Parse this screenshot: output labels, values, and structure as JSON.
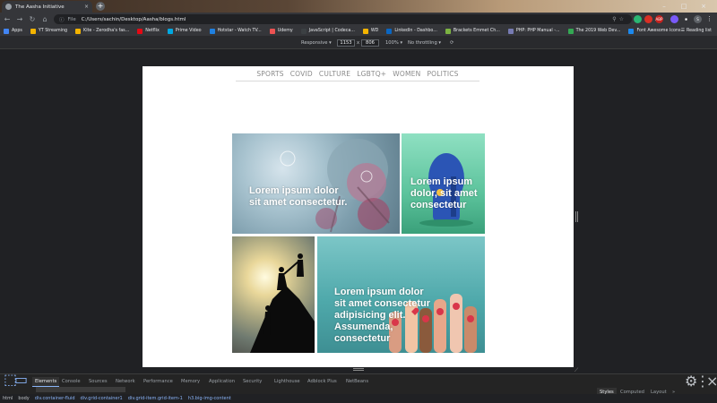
{
  "browser": {
    "tab_title": "The Aasha Initiative",
    "tab_close": "×",
    "new_tab": "+",
    "window_controls": [
      "–",
      "□",
      "×"
    ],
    "nav": {
      "back": "←",
      "forward": "→",
      "reload": "↻",
      "home": "⌂"
    },
    "omnibox": {
      "info": "ⓘ",
      "scheme_label": "File",
      "url": "C:/Users/sachin/Desktop/Aasha/blogs.html",
      "actions": "⚲☆"
    },
    "extensions": [
      {
        "label": "",
        "color": "#2bb673"
      },
      {
        "label": "",
        "color": "#d93025"
      },
      {
        "label": "ABP",
        "color": "#c5221f"
      },
      {
        "label": "",
        "color": "#7a5af8"
      },
      {
        "label": "S",
        "color": "#5f6368"
      }
    ],
    "menu": "⋮"
  },
  "bookmarks": [
    {
      "label": "Apps",
      "color": "#4285f4"
    },
    {
      "label": "YT Streaming",
      "color": "#f4b400"
    },
    {
      "label": "Kite - Zerodha's fas...",
      "color": "#f4b400"
    },
    {
      "label": "Netflix",
      "color": "#e50914"
    },
    {
      "label": "Prime Video",
      "color": "#00a8e1"
    },
    {
      "label": "Hotstar - Watch TV...",
      "color": "#1f80e0"
    },
    {
      "label": "Udemy",
      "color": "#ec5252"
    },
    {
      "label": "JavaScript | Codeca...",
      "color": "#3c4043"
    },
    {
      "label": "WD",
      "color": "#f4b400"
    },
    {
      "label": "LinkedIn - Dashbo...",
      "color": "#0a66c2"
    },
    {
      "label": "Brackets Emmet Ch...",
      "color": "#7cb342"
    },
    {
      "label": "PHP: PHP Manual -...",
      "color": "#777bb3"
    },
    {
      "label": "The 2019 Web Dev...",
      "color": "#34a853"
    },
    {
      "label": "Font Awesome Icons",
      "color": "#1c88ed"
    }
  ],
  "reading_list": "Reading list",
  "device_toolbar": {
    "mode": "Responsive ▾",
    "width": "1153",
    "x": "x",
    "height": "806",
    "zoom": "100% ▾",
    "throttle": "No throttling ▾",
    "rotate": "⟳"
  },
  "page": {
    "nav_items": [
      "SPORTS",
      "COVID",
      "CULTURE",
      "LGBTQ+",
      "WOMEN",
      "POLITICS"
    ],
    "cards": [
      {
        "text": "Lorem ipsum dolor sit amet consectetur."
      },
      {
        "text": "Lorem ipsum dolor, sit amet consectetur"
      },
      {
        "text": ""
      },
      {
        "text": "Lorem ipsum dolor sit amet consectetur adipisicing elit. Assumenda, consectetur"
      }
    ]
  },
  "devtools": {
    "tabs": [
      "Elements",
      "Console",
      "Sources",
      "Network",
      "Performance",
      "Memory",
      "Application",
      "Security",
      "Lighthouse",
      "Adblock Plus",
      "NetBeans"
    ],
    "active_tab": "Elements",
    "settings_icon": "⚙",
    "more_icon": "⋮",
    "close_icon": "×",
    "side_tabs": [
      "Styles",
      "Computed",
      "Layout",
      "»"
    ],
    "breadcrumbs": [
      "html",
      "body",
      "div.container-fluid",
      "div.grid-container1",
      "div.grid-item.grid-item-1",
      "h3.big-img-content"
    ]
  }
}
